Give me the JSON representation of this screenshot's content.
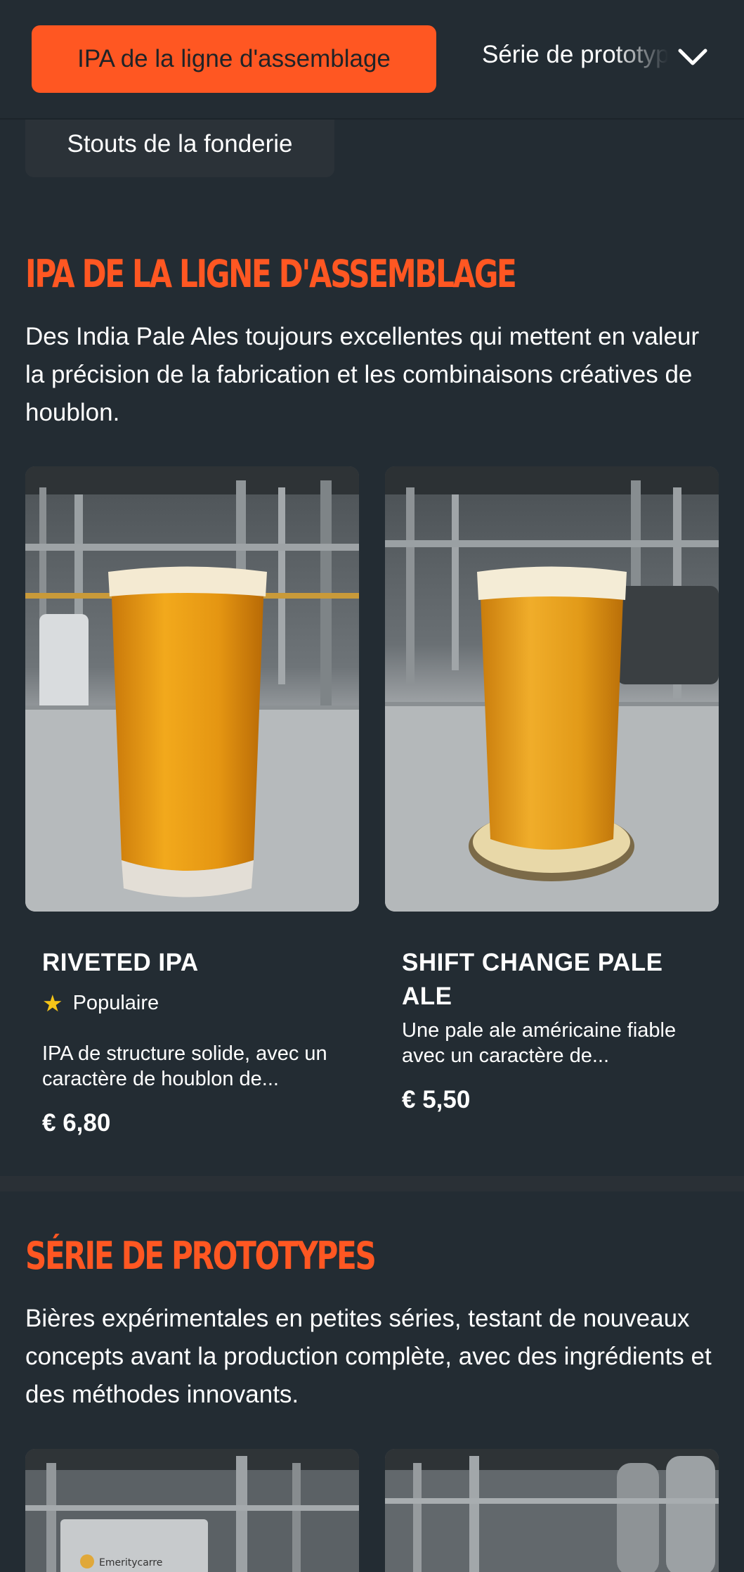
{
  "nav": {
    "active_tab": "IPA de la ligne d'assemblage",
    "next_tab": "Série de prototypes",
    "secondary_tab": "Stouts de la fonderie"
  },
  "sections": [
    {
      "title": "IPA DE LA LIGNE D'ASSEMBLAGE",
      "description": "Des India Pale Ales toujours excellentes qui mettent en valeur la précision de la fabrication et les combinaisons créatives de houblon.",
      "products": [
        {
          "name": "RIVETED IPA",
          "badge": "Populaire",
          "description": "IPA de structure solide, avec un caractère de houblon de...",
          "price": "€ 6,80"
        },
        {
          "name": "SHIFT CHANGE PALE ALE",
          "description": "Une pale ale américaine fiable avec un caractère de...",
          "price": "€ 5,50"
        }
      ]
    },
    {
      "title": "SÉRIE DE PROTOTYPES",
      "description": "Bières expérimentales en petites séries, testant de nouveaux concepts avant la production complète, avec des ingrédients et des méthodes innovants.",
      "label_on_image": "Emeritycarre"
    }
  ],
  "icons": {
    "chevron": "chevron-down-icon",
    "star": "star-icon"
  },
  "colors": {
    "accent": "#ff5722",
    "background": "#232c33",
    "star": "#f5c518"
  }
}
